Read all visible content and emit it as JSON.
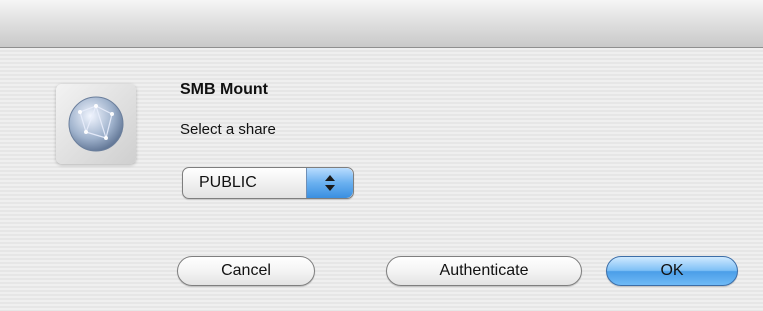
{
  "dialog": {
    "title": "SMB Mount",
    "prompt": "Select a share",
    "share_select": {
      "selected": "PUBLIC"
    },
    "buttons": {
      "cancel": "Cancel",
      "authenticate": "Authenticate",
      "ok": "OK"
    }
  },
  "icons": {
    "app_icon": "network-globe-icon",
    "popup_arrows": "chevron-updown-icon"
  },
  "colors": {
    "default_button": "#4b9ee8",
    "window_background": "#ededed"
  }
}
